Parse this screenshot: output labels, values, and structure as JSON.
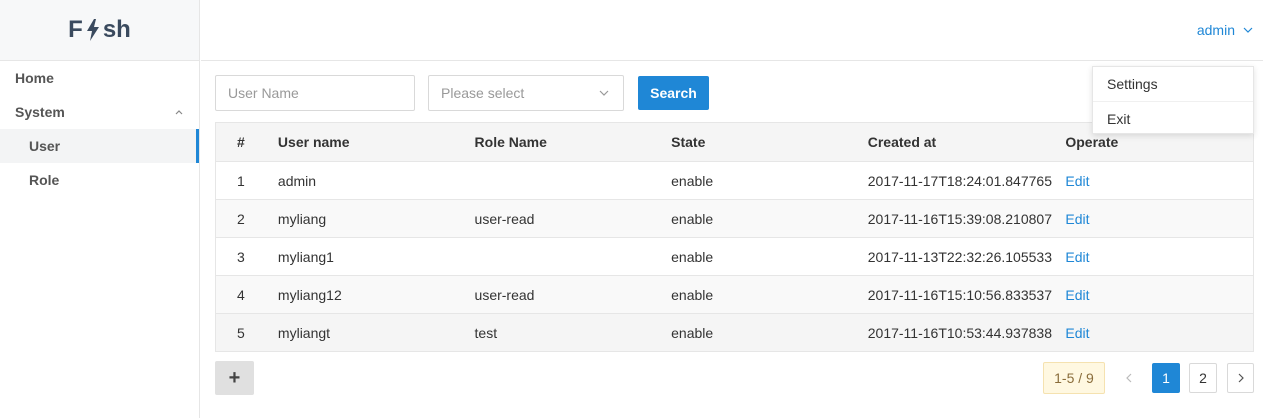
{
  "app": {
    "logo_left": "F",
    "logo_right": "sh"
  },
  "sidebar": {
    "items": [
      {
        "label": "Home"
      },
      {
        "label": "System"
      },
      {
        "label": "User"
      },
      {
        "label": "Role"
      }
    ]
  },
  "header": {
    "user_label": "admin"
  },
  "user_dropdown": {
    "items": [
      {
        "label": "Settings"
      },
      {
        "label": "Exit"
      }
    ]
  },
  "filters": {
    "user_name_placeholder": "User Name",
    "select_placeholder": "Please select",
    "search_label": "Search"
  },
  "table": {
    "columns": [
      "#",
      "User name",
      "Role Name",
      "State",
      "Created at",
      "Operate"
    ],
    "rows": [
      {
        "num": "1",
        "name": "admin",
        "role": "",
        "state": "enable",
        "created": "2017-11-17T18:24:01.847765",
        "op": "Edit"
      },
      {
        "num": "2",
        "name": "myliang",
        "role": "user-read",
        "state": "enable",
        "created": "2017-11-16T15:39:08.210807",
        "op": "Edit"
      },
      {
        "num": "3",
        "name": "myliang1",
        "role": "",
        "state": "enable",
        "created": "2017-11-13T22:32:26.105533",
        "op": "Edit"
      },
      {
        "num": "4",
        "name": "myliang12",
        "role": "user-read",
        "state": "enable",
        "created": "2017-11-16T15:10:56.833537",
        "op": "Edit"
      },
      {
        "num": "5",
        "name": "myliangt",
        "role": "test",
        "state": "enable",
        "created": "2017-11-16T10:53:44.937838",
        "op": "Edit"
      }
    ]
  },
  "footer": {
    "add_label": "+",
    "pager_total": "1-5 / 9",
    "pages": [
      "1",
      "2"
    ]
  },
  "colors": {
    "accent": "#1f87d6"
  }
}
